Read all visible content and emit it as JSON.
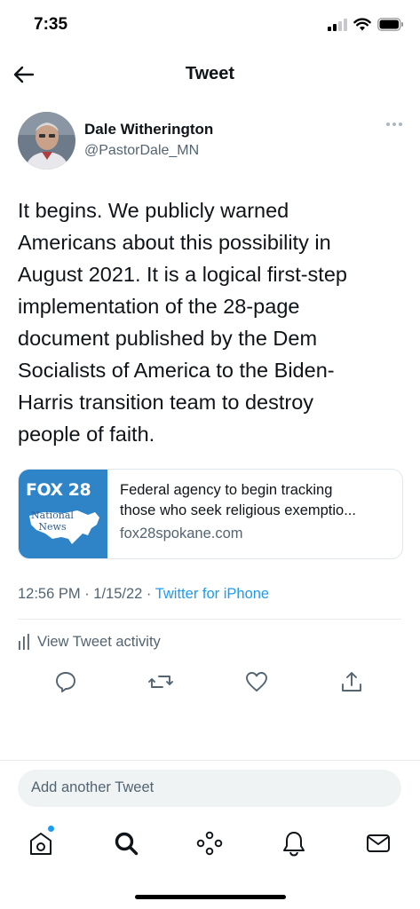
{
  "status_bar": {
    "time": "7:35"
  },
  "nav": {
    "title": "Tweet"
  },
  "author": {
    "name": "Dale Witherington",
    "handle": "@PastorDale_MN"
  },
  "tweet": {
    "text_lines": [
      "It begins. We publicly warned",
      "Americans about this possibility in",
      "August 2021. It is a logical first-step",
      "implementation of the 28-page",
      "document published by the Dem",
      "Socialists of America to the Biden-",
      "Harris transition team to destroy",
      "people of faith."
    ],
    "timestamp": "12:56 PM · 1/15/22 · ",
    "source": "Twitter for iPhone"
  },
  "link_card": {
    "thumb_brand": "FOX 28",
    "thumb_sub_1": "National",
    "thumb_sub_2": "News",
    "title_line_1": "Federal agency to begin tracking",
    "title_line_2": "those who seek religious exemptio...",
    "domain": "fox28spokane.com"
  },
  "activity": {
    "label": "View Tweet activity"
  },
  "actions": [
    "reply-icon",
    "retweet-icon",
    "like-icon",
    "share-icon"
  ],
  "reply_box": {
    "placeholder": "Add another Tweet"
  },
  "tabbar": {
    "items": [
      "home-icon",
      "search-icon",
      "spaces-icon",
      "notifications-icon",
      "messages-icon"
    ],
    "accent": "#1d9bf0"
  },
  "colors": {
    "accent": "#1d9bf0",
    "secondary_text": "#536471",
    "fox_blue": "#2f84c8"
  }
}
